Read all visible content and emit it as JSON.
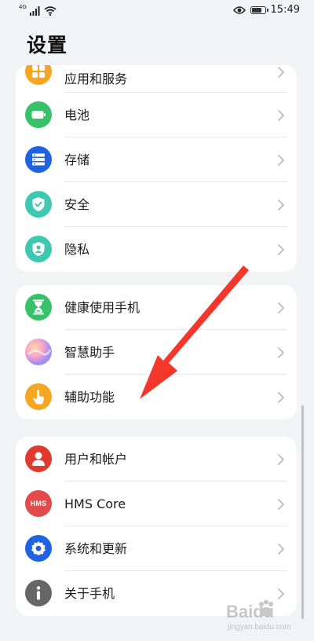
{
  "status_bar": {
    "network": "4G",
    "time": "15:49",
    "battery_level": 0.85
  },
  "page": {
    "title": "设置"
  },
  "groups": [
    {
      "items": [
        {
          "label": "应用和服务",
          "icon": "apps-icon",
          "color": "#f5a623"
        },
        {
          "label": "电池",
          "icon": "battery-icon",
          "color": "#37c26a"
        },
        {
          "label": "存储",
          "icon": "storage-icon",
          "color": "#1f63e0"
        },
        {
          "label": "安全",
          "icon": "shield-icon",
          "color": "#3ec7b1"
        },
        {
          "label": "隐私",
          "icon": "privacy-icon",
          "color": "#3ec7b1"
        }
      ]
    },
    {
      "items": [
        {
          "label": "健康使用手机",
          "icon": "hourglass-icon",
          "color": "#37c26a"
        },
        {
          "label": "智慧助手",
          "icon": "assistant-orb-icon",
          "color": "#8a7bf0"
        },
        {
          "label": "辅助功能",
          "icon": "hand-pointer-icon",
          "color": "#f5a623"
        }
      ]
    },
    {
      "items": [
        {
          "label": "用户和帐户",
          "icon": "user-icon",
          "color": "#e03a2e"
        },
        {
          "label": "HMS Core",
          "icon": "hms-icon",
          "icon_text": "HMS",
          "color": "#e34b4b"
        },
        {
          "label": "系统和更新",
          "icon": "gear-icon",
          "color": "#1f63e0"
        },
        {
          "label": "关于手机",
          "icon": "info-icon",
          "color": "#666666"
        }
      ]
    }
  ],
  "annotation": {
    "arrow_color": "#e8221c"
  },
  "watermark": {
    "text": "Baidu",
    "subtext": "jingyan.baidu.com"
  }
}
